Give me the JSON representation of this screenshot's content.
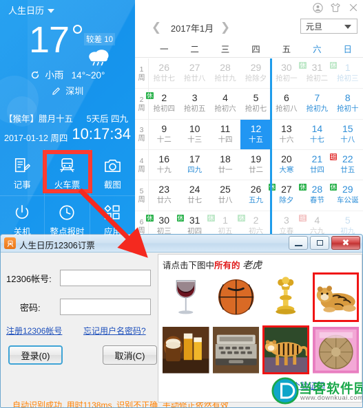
{
  "app": {
    "title": "人生日历",
    "window_icons": [
      "user-avatar-icon",
      "tshirt-skin-icon",
      "close-icon"
    ]
  },
  "weather": {
    "temperature": "17",
    "aqi": "较差 10",
    "condition": "小雨",
    "range": "14°~20°",
    "city": "深圳",
    "icon": "rain-cloud-icon"
  },
  "datetime": {
    "lunar_year": "【猴年】腊月十五",
    "countdown": "5天后 四九",
    "date": "2017-01-12 周四",
    "time": "10:17:34"
  },
  "tools": [
    {
      "label": "记事",
      "icon": "note-icon"
    },
    {
      "label": "火车票",
      "icon": "train-ticket-icon"
    },
    {
      "label": "截图",
      "icon": "camera-icon"
    },
    {
      "label": "关机",
      "icon": "power-icon"
    },
    {
      "label": "整点报时",
      "icon": "clock-icon"
    },
    {
      "label": "应用",
      "icon": "apps-icon"
    }
  ],
  "calendar": {
    "month_label": "2017年1月",
    "prev_icon": "chevron-left-icon",
    "next_icon": "chevron-right-icon",
    "festival_selected": "元旦",
    "weekdays": [
      "一",
      "二",
      "三",
      "四",
      "五",
      "六",
      "日"
    ],
    "week_numbers": [
      "1",
      "2",
      "3",
      "4",
      "5",
      "6"
    ],
    "week_suffix": "周",
    "rest_tag": "休",
    "work_tag": "班",
    "rows": [
      [
        {
          "d": "26",
          "l": "抢廿七",
          "out": true
        },
        {
          "d": "27",
          "l": "抢廿八",
          "out": true
        },
        {
          "d": "28",
          "l": "抢廿九",
          "out": true
        },
        {
          "d": "29",
          "l": "抢除夕",
          "out": true
        },
        {
          "d": "30",
          "l": "抢初一",
          "out": true
        },
        {
          "d": "31",
          "l": "抢初二",
          "out": true,
          "tag": "rest"
        },
        {
          "d": "1",
          "l": "抢初三",
          "out": true,
          "weekend": true,
          "tag": "rest"
        }
      ],
      [
        {
          "d": "2",
          "l": "抢初四",
          "tag": "rest"
        },
        {
          "d": "3",
          "l": "抢初五"
        },
        {
          "d": "4",
          "l": "抢初六"
        },
        {
          "d": "5",
          "l": "抢初七"
        },
        {
          "d": "6",
          "l": "抢初八"
        },
        {
          "d": "7",
          "l": "抢初九",
          "weekend": true
        },
        {
          "d": "8",
          "l": "抢初十",
          "weekend": true
        }
      ],
      [
        {
          "d": "9",
          "l": "十二"
        },
        {
          "d": "10",
          "l": "十三"
        },
        {
          "d": "11",
          "l": "十四"
        },
        {
          "d": "12",
          "l": "十五",
          "today": true
        },
        {
          "d": "13",
          "l": "十六"
        },
        {
          "d": "14",
          "l": "十七",
          "weekend": true
        },
        {
          "d": "15",
          "l": "十八",
          "weekend": true
        }
      ],
      [
        {
          "d": "16",
          "l": "十九"
        },
        {
          "d": "17",
          "l": "四九",
          "blue_lunar": true
        },
        {
          "d": "18",
          "l": "廿一"
        },
        {
          "d": "19",
          "l": "廿二"
        },
        {
          "d": "20",
          "l": "大寒",
          "blue_lunar": true
        },
        {
          "d": "21",
          "l": "廿四",
          "weekend": true
        },
        {
          "d": "22",
          "l": "廿五",
          "weekend": true,
          "tag": "work"
        }
      ],
      [
        {
          "d": "23",
          "l": "廿六"
        },
        {
          "d": "24",
          "l": "廿七"
        },
        {
          "d": "25",
          "l": "廿八"
        },
        {
          "d": "26",
          "l": "五九",
          "blue_lunar": true
        },
        {
          "d": "27",
          "l": "除夕",
          "blue_lunar": true,
          "tag": "rest"
        },
        {
          "d": "28",
          "l": "春节",
          "weekend": true,
          "tag": "rest"
        },
        {
          "d": "29",
          "l": "车公诞",
          "weekend": true,
          "tag": "rest"
        }
      ],
      [
        {
          "d": "30",
          "l": "初三",
          "tag": "rest"
        },
        {
          "d": "31",
          "l": "初四",
          "tag": "rest"
        },
        {
          "d": "1",
          "l": "初五",
          "out": true,
          "tag": "rest"
        },
        {
          "d": "2",
          "l": "初六",
          "out": true,
          "tag": "rest"
        },
        {
          "d": "3",
          "l": "立春",
          "out": true
        },
        {
          "d": "4",
          "l": "六九",
          "out": true,
          "tag": "work"
        },
        {
          "d": "5",
          "l": "初九",
          "out": true,
          "weekend": true
        }
      ]
    ]
  },
  "dialog": {
    "title": "人生日历12306订票",
    "icon": "train-app-icon",
    "win_buttons": [
      {
        "name": "minimize",
        "glyph": "—"
      },
      {
        "name": "maximize",
        "glyph": "❐"
      },
      {
        "name": "close",
        "glyph": "✕"
      }
    ],
    "account_label": "12306帐号:",
    "account_value": "",
    "password_label": "密码:",
    "password_value": "",
    "register_link": "注册12306帐号",
    "forgot_link": "忘记用户名密码?",
    "login_button": "登录(0)",
    "cancel_button": "取消(C)",
    "status": "自动识别成功, 用时1138ms, 识别不正确, 手动修正依然有效"
  },
  "captcha": {
    "prompt_prefix": "请点击下图中",
    "prompt_highlight": "所有的",
    "prompt_target": "老虎",
    "refresh_link": "换一个验证码",
    "images": [
      {
        "name": "wine-glass",
        "selected": false
      },
      {
        "name": "basketball",
        "selected": false
      },
      {
        "name": "gold-candlestick",
        "selected": false
      },
      {
        "name": "tiger-lying",
        "selected": true
      },
      {
        "name": "beer-glasses",
        "selected": false
      },
      {
        "name": "typewriter",
        "selected": false
      },
      {
        "name": "tiger-walking",
        "selected": true
      },
      {
        "name": "gong-disc",
        "selected": false
      }
    ]
  },
  "watermark": {
    "name": "当客软件园",
    "url": "www.downkuai.com"
  },
  "annotations": {
    "highlight_target": "火车票",
    "arrow": "red-arrow-pointer"
  },
  "colors": {
    "brand_blue": "#1b9df0",
    "today_blue": "#2196f3",
    "rest_green": "#2bb24c",
    "work_red": "#e44141",
    "status_orange": "#ff8000",
    "annotation_red": "#ff3b30"
  }
}
